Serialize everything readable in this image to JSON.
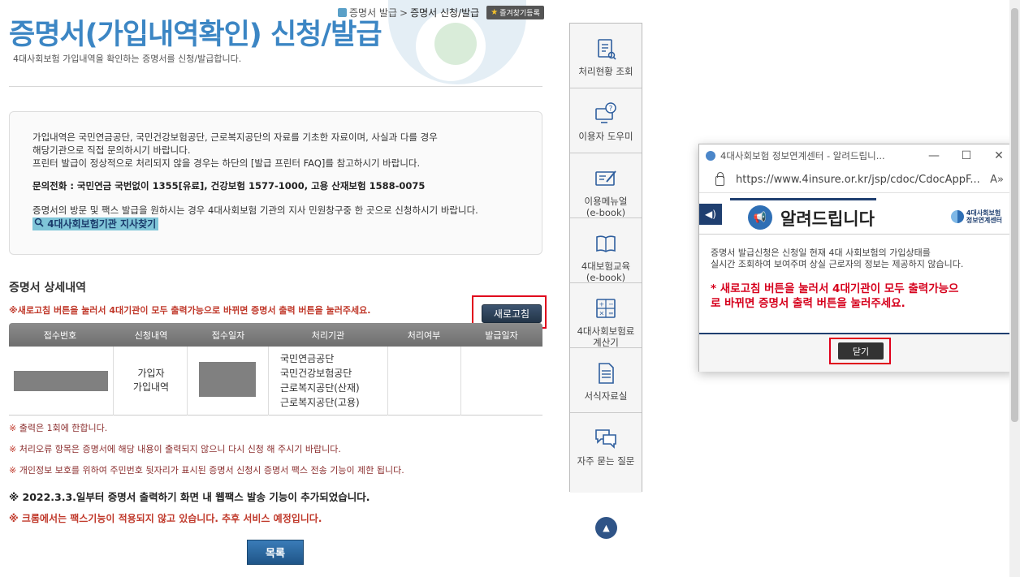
{
  "header": {
    "title": "증명서(가입내역확인) 신청/발급",
    "subtitle": "4대사회보험 가입내역을 확인하는 증명서를 신청/발급합니다.",
    "breadcrumb": [
      "증명서 발급",
      "증명서 신청/발급"
    ],
    "breadcrumb_sep": ">",
    "favorite_label": "즐겨찾기등록"
  },
  "info": {
    "lines": [
      "가입내역은 국민연금공단, 국민건강보험공단, 근로복지공단의 자료를 기초한 자료이며, 사실과 다를 경우",
      "해당기관으로 직접 문의하시기 바랍니다.",
      "프린터 발급이 정상적으로 처리되지 않을 경우는 하단의 [발급 프린터 FAQ]를 참고하시기 바랍니다."
    ],
    "contact": "문의전화 : 국민연금 국번없이 1355[유료], 건강보험 1577-1000, 고용 산재보험 1588-0075",
    "visit": "증명서의 방문 및 팩스 발급을 원하시는 경우 4대사회보험 기관의 지사 민원창구중 한 곳으로 신청하시기 바랍니다.",
    "branch_link": "4대사회보험기관 지사찾기"
  },
  "detail": {
    "title": "증명서 상세내역",
    "refresh_note": "※새로고침 버튼을 눌러서 4대기관이 모두 출력가능으로 바뀌면 증명서 출력 버튼을 눌러주세요.",
    "refresh_label": "새로고침",
    "columns": [
      "접수번호",
      "신청내역",
      "접수일자",
      "처리기관",
      "처리여부",
      "발급일자"
    ],
    "row": {
      "type_line1": "가입자",
      "type_line2": "가입내역",
      "agencies": [
        "국민연금공단",
        "국민건강보험공단",
        "근로복지공단(산재)",
        "근로복지공단(고용)"
      ]
    }
  },
  "notes": {
    "mark": "※",
    "items": [
      "출력은 1회에 한합니다.",
      "처리오류 항목은 증명서에 해당 내용이 출력되지 않으니 다시 신청 해 주시기 바랍니다.",
      "개인정보 보호를 위하여 주민번호 뒷자리가 표시된 증명서 신청시 증명서 팩스 전송 기능이 제한 됩니다."
    ],
    "bold1": "※ 2022.3.3.일부터 증명서 출력하기 화면 내 웹팩스 발송 기능이 추가되었습니다.",
    "bold2": "※ 크롬에서는 팩스기능이 적용되지 않고 있습니다. 추후 서비스 예정입니다."
  },
  "list_label": "목록",
  "quick_menu": [
    {
      "label": "처리현황 조회",
      "icon": "clipboard-search-icon"
    },
    {
      "label": "이용자 도우미",
      "icon": "monitor-help-icon"
    },
    {
      "label": "이용메뉴얼\n(e-book)",
      "icon": "pencil-manual-icon"
    },
    {
      "label": "4대보험교육\n(e-book)",
      "icon": "open-book-icon"
    },
    {
      "label": "4대사회보험료\n계산기",
      "icon": "calculator-icon"
    },
    {
      "label": "서식자료실",
      "icon": "document-icon"
    },
    {
      "label": "자주 묻는 질문",
      "icon": "chat-bubble-icon"
    }
  ],
  "popup": {
    "window_title": "4대사회보험 정보연계센터 - 알려드립니...",
    "url": "https://www.4insure.or.kr/jsp/cdoc/CdocAppF...",
    "heading": "알려드립니다",
    "org_name": "4대사회보험\n정보연계센터",
    "text": "증명서 발급신청은 신청일 현재 4대 사회보험의 가입상태를\n실시간 조회하여 보여주며 상실 근로자의 정보는 제공하지 않습니다.",
    "warning": "* 새로고침 버튼을 눌러서 4대기관이 모두 출력가능으\n로 바뀌면 증명서 출력 버튼을 눌러주세요.",
    "close_label": "닫기"
  },
  "colors": {
    "title_blue": "#3c86c4",
    "warning_red": "#d6001c",
    "highlight": "#e0001b",
    "navy": "#1f3f70"
  }
}
